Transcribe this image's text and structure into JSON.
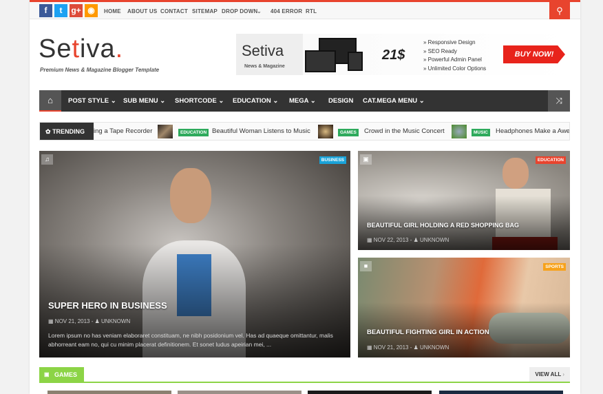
{
  "topbar": {
    "social": [
      {
        "icon": "facebook-icon",
        "glyph": "f",
        "color": "#3b5998"
      },
      {
        "icon": "twitter-icon",
        "glyph": "t",
        "color": "#1da1f2"
      },
      {
        "icon": "google-plus-icon",
        "glyph": "g+",
        "color": "#dd4b39"
      },
      {
        "icon": "rss-icon",
        "glyph": "◉",
        "color": "#f90"
      }
    ],
    "links": [
      "HOME",
      "ABOUT US",
      "CONTACT",
      "SITEMAP",
      "DROP DOWN",
      "404 ERROR",
      "RTL"
    ]
  },
  "logo": {
    "pre": "Se",
    "t": "t",
    "post": "iva",
    "dot": ".",
    "tagline": "Premium News & Magazine Blogger Template"
  },
  "ad": {
    "brand": "Setiva",
    "sub": "News & Magazine",
    "price": "21$",
    "features": [
      "Responsive Design",
      "SEO Ready",
      "Powerful Admin Panel",
      "Unlimited Color Options"
    ],
    "cta": "BUY NOW!"
  },
  "nav": [
    "POST STYLE",
    "SUB MENU",
    "SHORTCODE",
    "EDUCATION",
    "MEGA",
    "DESIGN",
    "CAT.MEGA MENU"
  ],
  "trending": {
    "label": "TRENDING",
    "items": [
      {
        "title": "ing a Tape Recorder"
      },
      {
        "badge": "EDUCATION",
        "title": "Beautiful Woman Listens to Music"
      },
      {
        "badge": "GAMES",
        "title": "Crowd in the Music Concert"
      },
      {
        "badge": "MUSIC",
        "title": "Headphones Make a Awes"
      }
    ]
  },
  "hero": {
    "badge": "BUSINESS",
    "badge_color": "#1aa3d9",
    "title": "SUPER HERO IN BUSINESS",
    "date": "NOV 21, 2013",
    "author": "UNKNOWN",
    "excerpt": "Lorem ipsum no has veniam elaboraret constituam, ne nibh posidonium vel. Has ad quaeque omittantur, malis abhorreant eam no, qui cu minim placerat definitionem. Et sonet ludus apeirian mei, ..."
  },
  "side": [
    {
      "badge": "EDUCATION",
      "badge_color": "#e8442e",
      "title": "BEAUTIFUL GIRL HOLDING A RED SHOPPING BAG",
      "date": "NOV 22, 2013",
      "author": "UNKNOWN"
    },
    {
      "badge": "SPORTS",
      "badge_color": "#f7a21b",
      "title": "BEAUTIFUL FIGHTING GIRL IN ACTION",
      "date": "NOV 21, 2013",
      "author": "UNKNOWN"
    }
  ],
  "games": {
    "label": "GAMES",
    "view_all": "VIEW ALL"
  }
}
